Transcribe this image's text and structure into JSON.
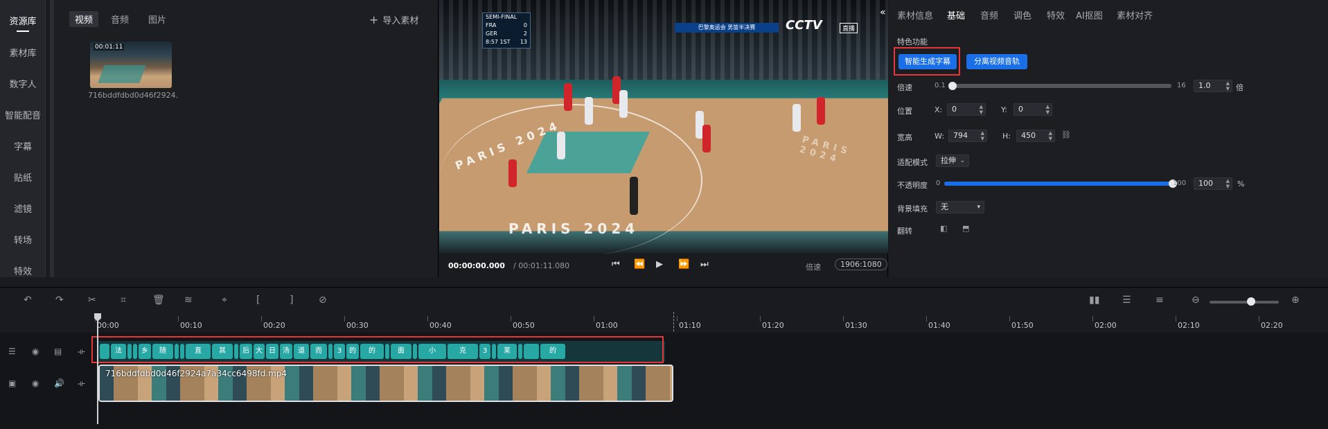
{
  "left_nav": {
    "items": [
      "资源库",
      "素材库",
      "数字人",
      "智能配音",
      "字幕",
      "贴纸",
      "滤镜",
      "转场",
      "特效"
    ]
  },
  "media_panel": {
    "tabs": [
      "视频",
      "音频",
      "图片"
    ],
    "import_label": "导入素材",
    "clip": {
      "duration": "00:01:11",
      "name": "716bddfdbd0d46f2924..."
    }
  },
  "preview": {
    "scorebug": {
      "header": "SEMI-FINAL",
      "team1": "FRA",
      "score1": "0",
      "team2": "GER",
      "score2": "2",
      "clock": "8:57",
      "period": "1ST",
      "shot": "13"
    },
    "banner": "巴黎奥运会 男篮半决赛",
    "channel": "CCTV",
    "live": "直播",
    "court_text": "PARIS 2024",
    "time_current": "00:00:00.000",
    "time_total": "/ 00:01:11.080",
    "speed_label": "倍速",
    "resolution": "1906:1080"
  },
  "props": {
    "tabs": [
      "素材信息",
      "基础",
      "音频",
      "调色",
      "特效",
      "AI抠图",
      "素材对齐"
    ],
    "active_tab": "基础",
    "special_title": "特色功能",
    "btn_subtitles": "智能生成字幕",
    "btn_split_audio": "分离视频音轨",
    "speed": {
      "label": "倍速",
      "min": "0.1",
      "max": "16",
      "value": "1.0",
      "unit": "倍",
      "fraction": 0.0
    },
    "position": {
      "label": "位置",
      "x_label": "X:",
      "x": "0",
      "y_label": "Y:",
      "y": "0"
    },
    "size": {
      "label": "宽高",
      "w_label": "W:",
      "w": "794",
      "h_label": "H:",
      "h": "450"
    },
    "fit": {
      "label": "适配模式",
      "value": "拉伸"
    },
    "opacity": {
      "label": "不透明度",
      "min": "0",
      "max": "100",
      "value": "100",
      "unit": "%",
      "fraction": 1.0
    },
    "bg_fill": {
      "label": "背景填充",
      "value": "无"
    },
    "flip": {
      "label": "翻转"
    }
  },
  "timeline": {
    "ticks": [
      "00:00",
      "00:10",
      "00:20",
      "00:30",
      "00:40",
      "00:50",
      "01:00",
      "01:10",
      "01:20",
      "01:30",
      "01:40",
      "01:50",
      "02:00",
      "02:10",
      "02:20",
      "02"
    ],
    "subtitle_clips": [
      "",
      "法",
      "",
      "",
      "乡",
      "随",
      "",
      "",
      "直",
      "其",
      "",
      "后",
      "大",
      "日",
      "汤",
      "道",
      "而",
      "",
      "3",
      "的",
      "的",
      "",
      "面",
      "",
      "小",
      "克",
      "3",
      "",
      "莱",
      "",
      "",
      "的"
    ],
    "video_clip_name": "716bddfdbd0d46f2924a7a34cc6498fd.mp4"
  },
  "colors": {
    "accent": "#1a6fe8",
    "highlight": "#e8373a",
    "subtitle_clip": "#27a8a5"
  }
}
